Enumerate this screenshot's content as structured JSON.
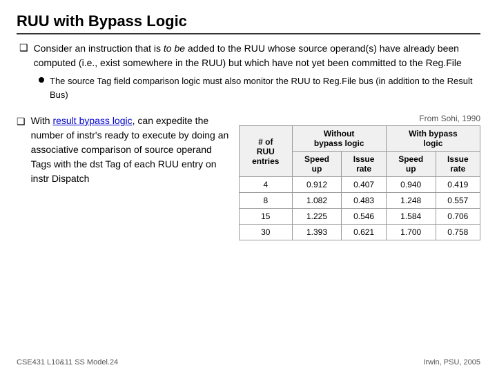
{
  "title": "RUU with Bypass Logic",
  "bullet1": {
    "diamond": "❑",
    "text_parts": [
      "Consider an instruction that is ",
      "to be",
      " added to the RUU whose source operand(s) have already been computed (i.e., exist somewhere in the RUU) but which have not yet been committed to the Reg.File"
    ]
  },
  "sub_bullet": {
    "text": "The source Tag field comparison logic must also monitor the RUU to Reg.File bus (in addition to the Result Bus)"
  },
  "bullet2": {
    "diamond": "❑",
    "prefix": "With ",
    "link_text": "result bypass logic",
    "suffix": ", can expedite the number of instr's ready to execute by doing an associative comparison of source operand Tags with the dst Tag of each RUU entry on instr Dispatch"
  },
  "table": {
    "from_citation": "From Sohi, 1990",
    "headers": {
      "col1": "# of RUU entries",
      "col2_main": "Without bypass logic",
      "col3_main": "With bypass logic",
      "sub_speed_up": "Speed up",
      "sub_issue_rate": "Issue rate",
      "sub_speed_up2": "Speed up",
      "sub_issue_rate2": "Issue rate"
    },
    "rows": [
      {
        "entries": "4",
        "wu_speedup": "0.912",
        "wu_issue": "0.407",
        "wb_speedup": "0.940",
        "wb_issue": "0.419"
      },
      {
        "entries": "8",
        "wu_speedup": "1.082",
        "wu_issue": "0.483",
        "wb_speedup": "1.248",
        "wb_issue": "0.557"
      },
      {
        "entries": "15",
        "wu_speedup": "1.225",
        "wu_issue": "0.546",
        "wb_speedup": "1.584",
        "wb_issue": "0.706"
      },
      {
        "entries": "30",
        "wu_speedup": "1.393",
        "wu_issue": "0.621",
        "wb_speedup": "1.700",
        "wb_issue": "0.758"
      }
    ]
  },
  "footer": {
    "left": "CSE431  L10&11 SS Model.24",
    "right": "Irwin, PSU, 2005"
  }
}
